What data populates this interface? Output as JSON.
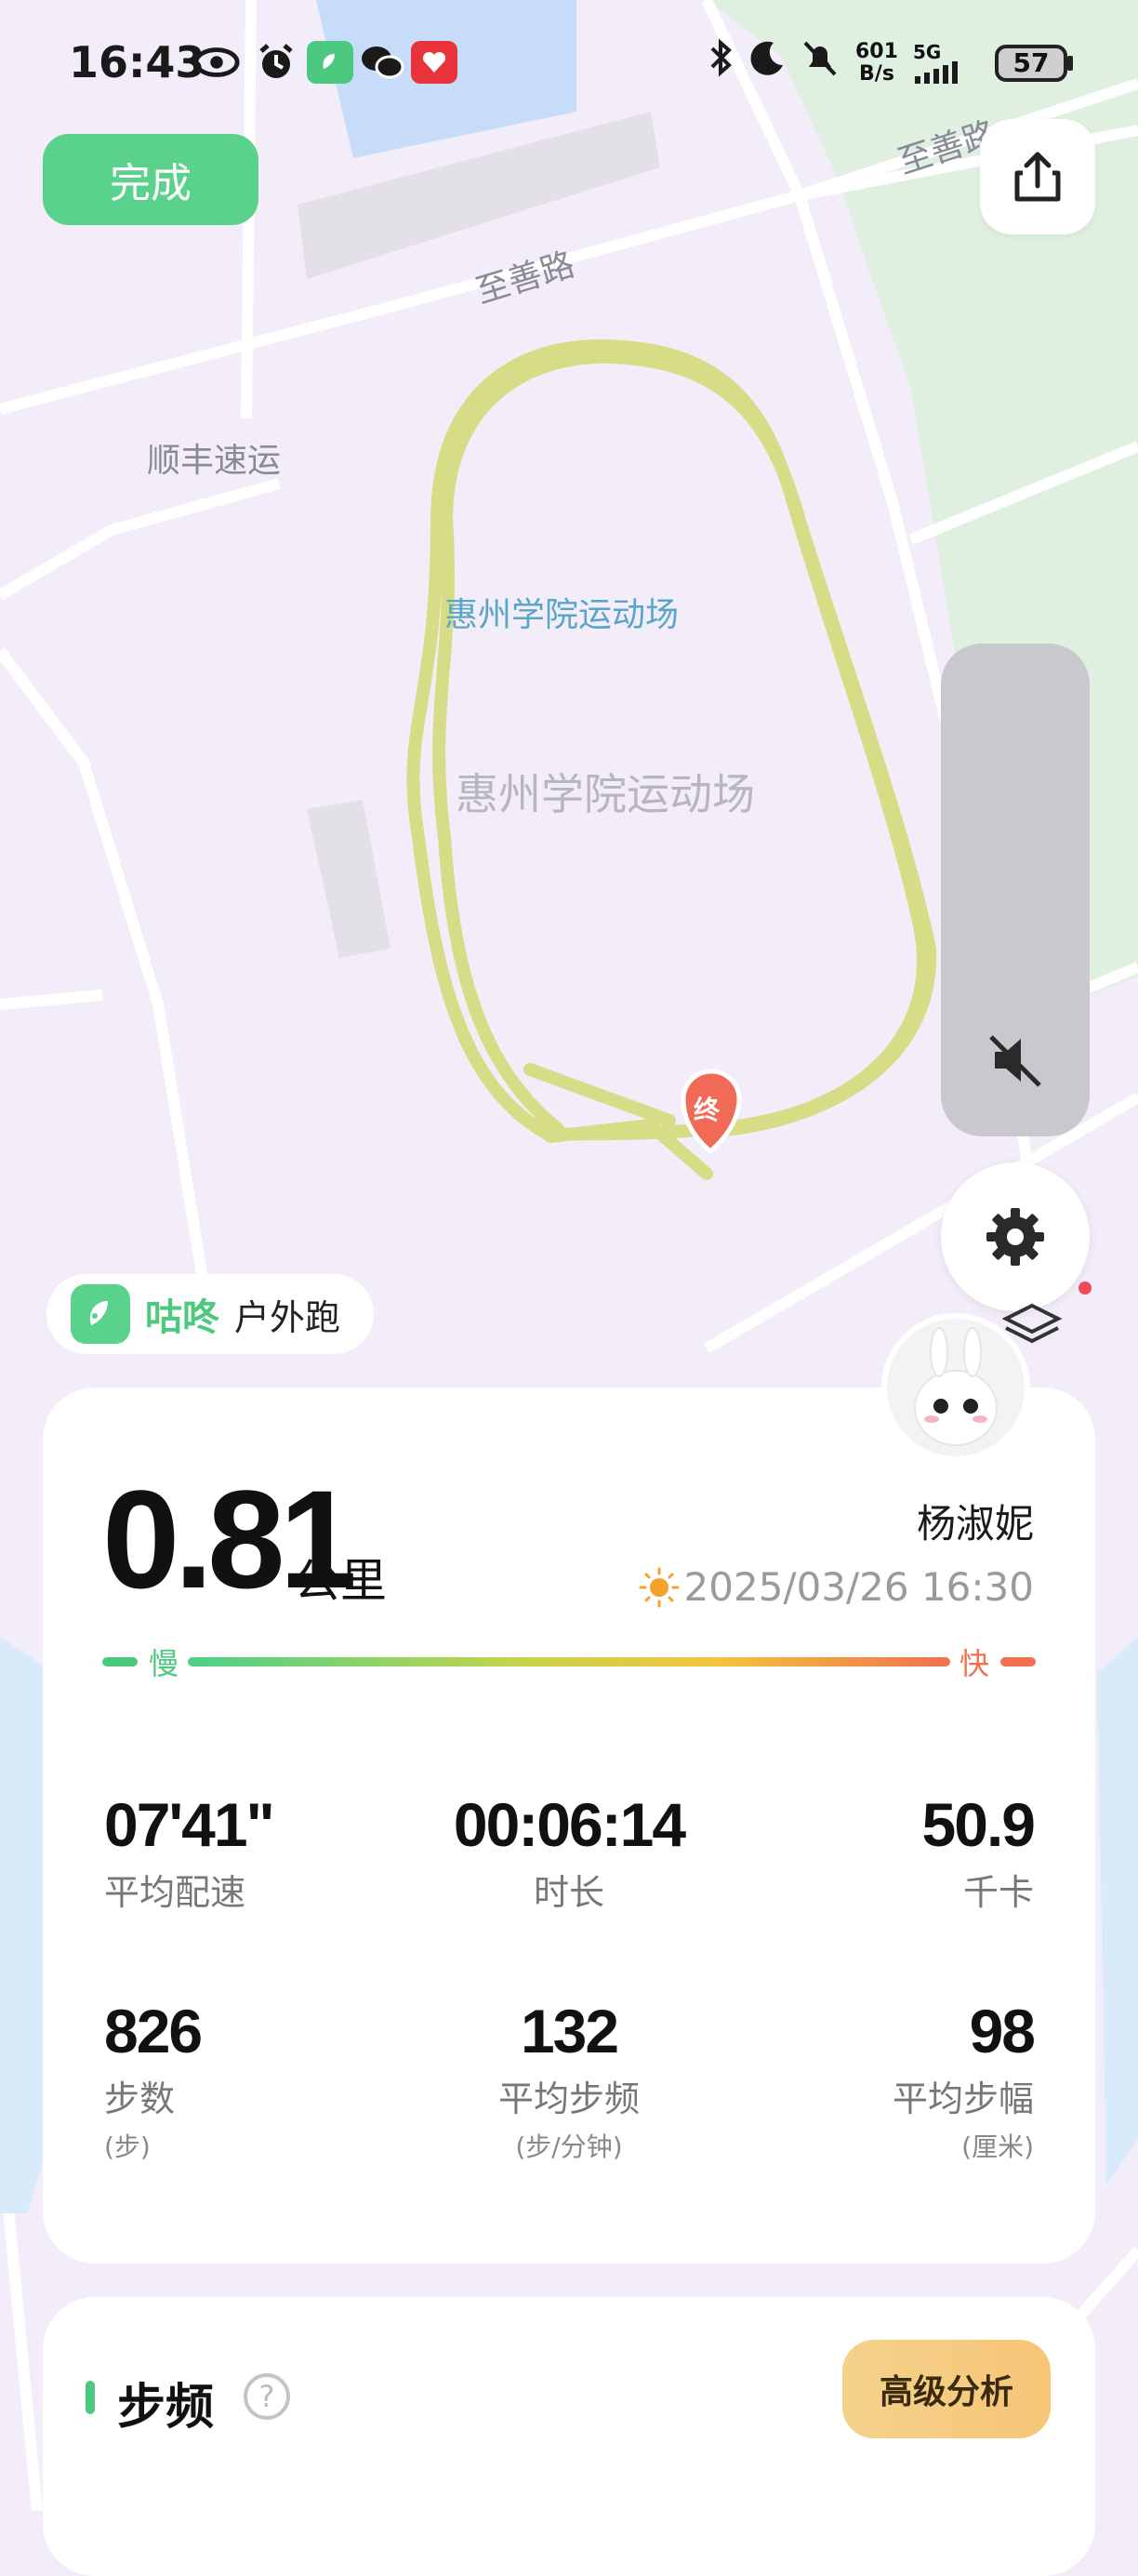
{
  "status_bar": {
    "time": "16:43",
    "net_speed_value": "601",
    "net_speed_unit": "B/s",
    "network": "5G",
    "battery": "57"
  },
  "top": {
    "done_label": "完成"
  },
  "map": {
    "road_labels": [
      "至善路",
      "至善路",
      "顺丰速运"
    ],
    "venue_label_blue": "惠州学院运动场",
    "venue_label_gray": "惠州学院运动场",
    "end_marker": "终"
  },
  "brand": {
    "name": "咕咚",
    "activity": "户外跑"
  },
  "summary": {
    "distance": "0.81",
    "distance_unit": "公里",
    "username": "杨淑妮",
    "datetime": "2025/03/26 16:30",
    "pace_slow": "慢",
    "pace_fast": "快"
  },
  "stats": [
    {
      "value": "07'41\"",
      "label": "平均配速",
      "unit": ""
    },
    {
      "value": "00:06:14",
      "label": "时长",
      "unit": ""
    },
    {
      "value": "50.9",
      "label": "千卡",
      "unit": ""
    },
    {
      "value": "826",
      "label": "步数",
      "unit": "(步)"
    },
    {
      "value": "132",
      "label": "平均步频",
      "unit": "(步/分钟)"
    },
    {
      "value": "98",
      "label": "平均步幅",
      "unit": "(厘米)"
    }
  ],
  "cadence_card": {
    "title": "步频",
    "help": "?",
    "advanced_button": "高级分析"
  },
  "colors": {
    "accent_green": "#5ad28c",
    "route": "#d5dc7e",
    "fast": "#f07050"
  }
}
